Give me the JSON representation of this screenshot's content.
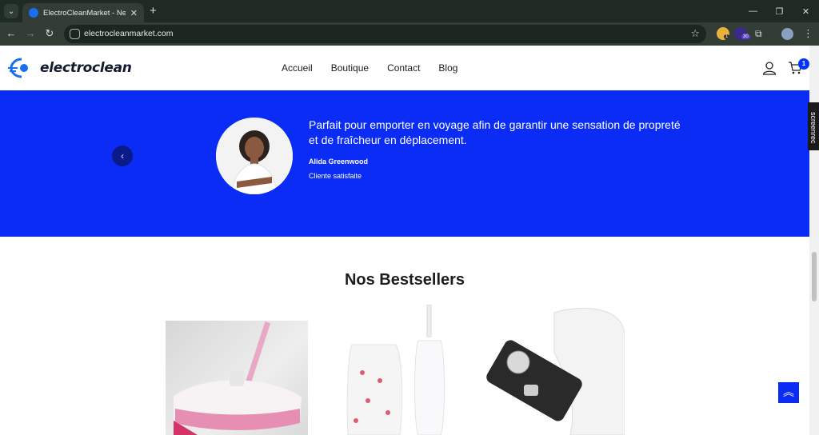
{
  "browser": {
    "tab_title": "ElectroCleanMarket - Nettoyage",
    "url": "electrocleanmarket.com",
    "extension_badge_1": "1",
    "extension_badge_2": "30"
  },
  "site": {
    "logo_text": "electroclean",
    "nav": [
      "Accueil",
      "Boutique",
      "Contact",
      "Blog"
    ],
    "cart_count": "1",
    "brand_color": "#0a2cf5"
  },
  "testimonial": {
    "quote": "Parfait pour emporter en voyage afin de garantir une sensation de propreté et de fraîcheur en déplacement.",
    "author": "Alida Greenwood",
    "role": "Cliente satisfaite"
  },
  "bestsellers": {
    "title": "Nos Bestsellers"
  },
  "overlay": {
    "screenrec_label": "screenrec"
  }
}
